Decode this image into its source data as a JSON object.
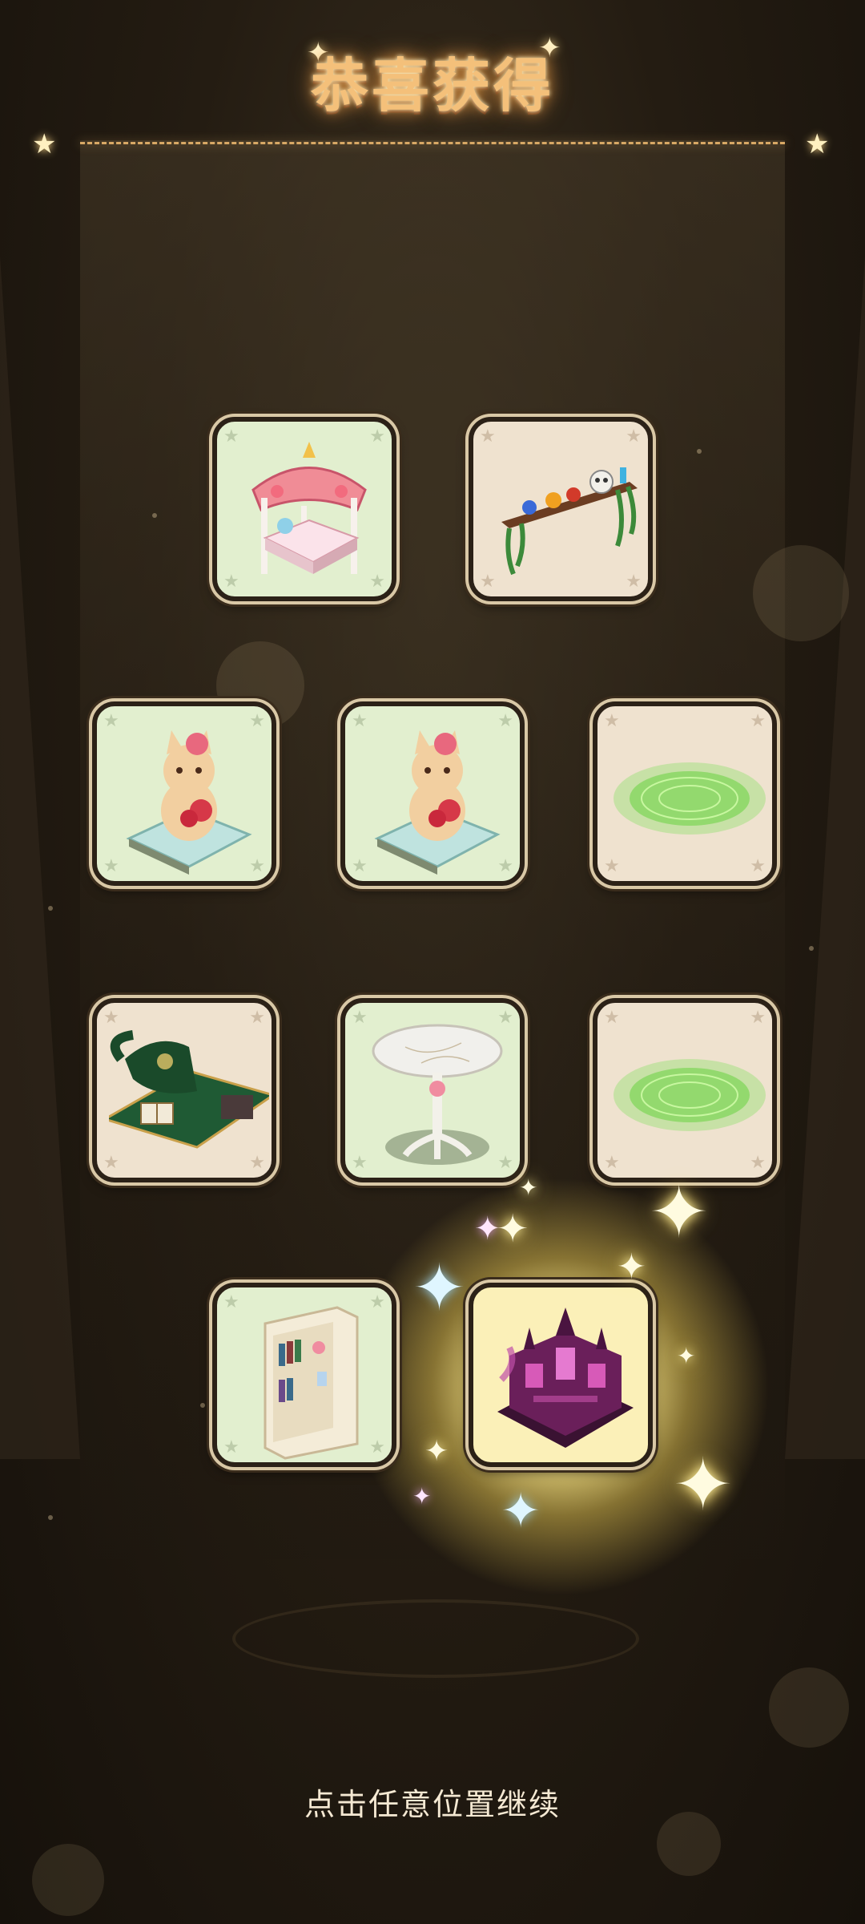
{
  "title": "恭喜获得",
  "continue_hint": "点击任意位置继续",
  "items": [
    {
      "id": "canopy-bed",
      "bg": "green",
      "icon": "canopy-bed-icon"
    },
    {
      "id": "potion-shelf",
      "bg": "beige",
      "icon": "potion-shelf-icon"
    },
    {
      "id": "cat-plush-1",
      "bg": "green",
      "icon": "cat-plush-icon"
    },
    {
      "id": "cat-plush-2",
      "bg": "green",
      "icon": "cat-plush-icon"
    },
    {
      "id": "magic-circle-1",
      "bg": "beige",
      "icon": "magic-circle-icon"
    },
    {
      "id": "witch-hat-rug",
      "bg": "beige",
      "icon": "witch-hat-rug-icon"
    },
    {
      "id": "marble-table",
      "bg": "green",
      "icon": "marble-table-icon"
    },
    {
      "id": "magic-circle-2",
      "bg": "beige",
      "icon": "magic-circle-icon"
    },
    {
      "id": "bookcase",
      "bg": "green",
      "icon": "bookcase-icon"
    },
    {
      "id": "gothic-mansion",
      "bg": "yellow",
      "icon": "gothic-mansion-icon",
      "rare": true
    }
  ],
  "colors": {
    "title": "#f4c07a",
    "slot_green": "#e2efcf",
    "slot_beige": "#efe2cf",
    "glow": "#ffe890"
  }
}
